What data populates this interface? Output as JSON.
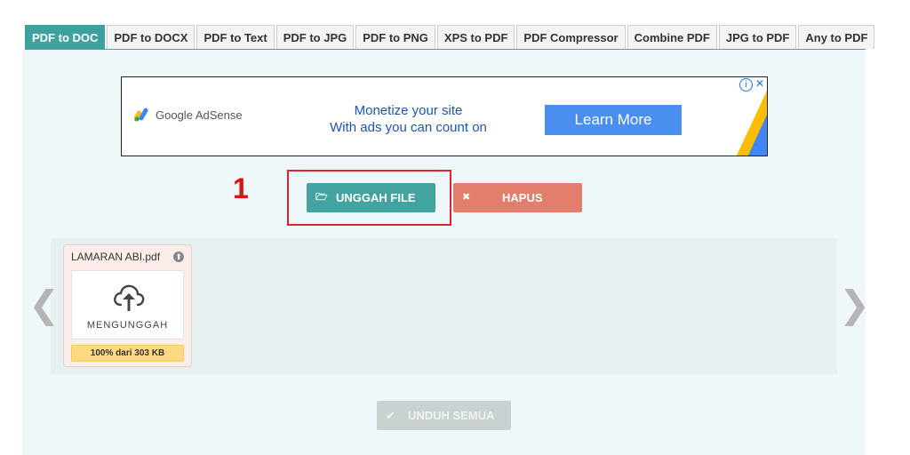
{
  "tabs": [
    "PDF to DOC",
    "PDF to DOCX",
    "PDF to Text",
    "PDF to JPG",
    "PDF to PNG",
    "XPS to PDF",
    "PDF Compressor",
    "Combine PDF",
    "JPG to PDF",
    "Any to PDF"
  ],
  "active_tab": 0,
  "ad": {
    "brand": "Google AdSense",
    "line1": "Monetize your site",
    "line2": "With ads you can count on",
    "cta": "Learn More"
  },
  "annotation": {
    "step": "1"
  },
  "actions": {
    "upload_label": "UNGGAH FILE",
    "clear_label": "HAPUS",
    "download_all_label": "UNDUH SEMUA"
  },
  "queue": {
    "prev_arrow": "❮",
    "next_arrow": "❯",
    "files": [
      {
        "name": "LAMARAN ABI.pdf",
        "status": "MENGUNGGAH",
        "progress_text": "100% dari 303 KB",
        "progress": 1.0
      }
    ]
  },
  "colors": {
    "accent": "#3fa0a0",
    "danger": "#e37d6c",
    "highlight": "#e0242b"
  }
}
